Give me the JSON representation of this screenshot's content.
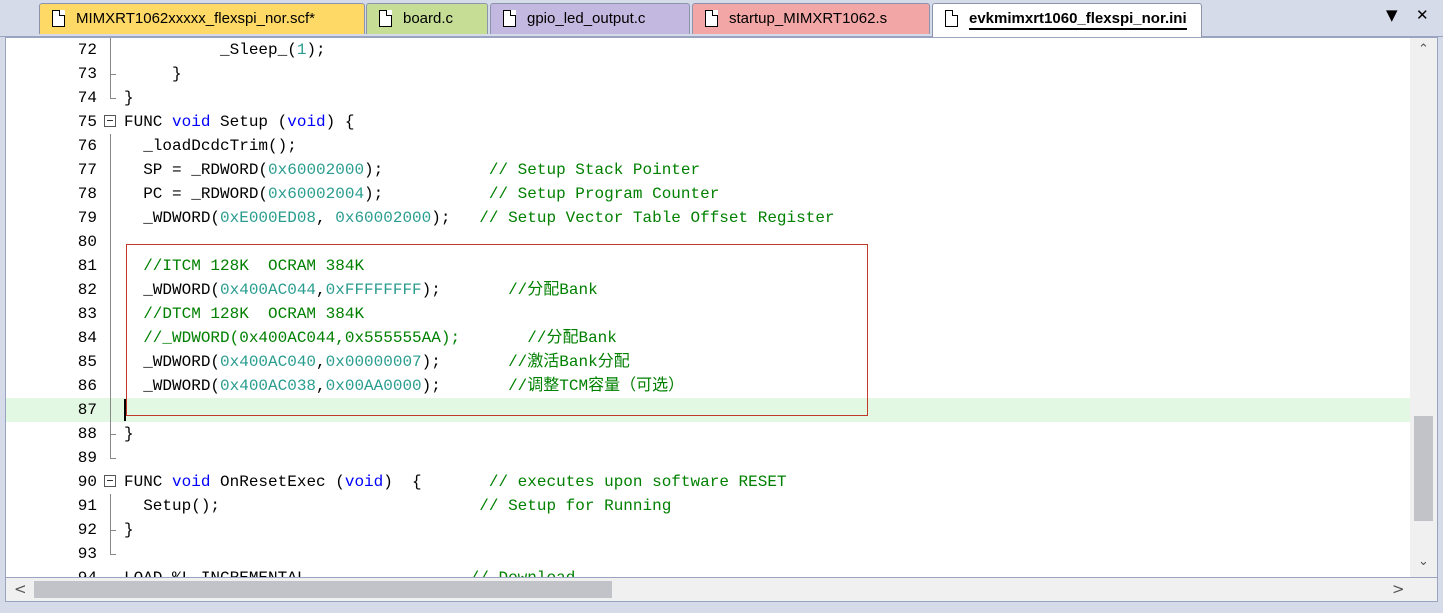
{
  "tabs": [
    {
      "label": "MIMXRT1062xxxxx_flexspi_nor.scf*",
      "color": "#ffd966",
      "active": false
    },
    {
      "label": "board.c",
      "color": "#c5dd95",
      "active": false
    },
    {
      "label": "gpio_led_output.c",
      "color": "#c3b8e0",
      "active": false
    },
    {
      "label": "startup_MIMXRT1062.s",
      "color": "#f2a6a6",
      "active": false
    },
    {
      "label": "evkmimxrt1060_flexspi_nor.ini",
      "color": "#ffffff",
      "active": true
    }
  ],
  "tab_controls": {
    "dropdown": "▼",
    "close": "✕"
  },
  "colors": {
    "keyword": "#0000ff",
    "number": "#2a9d8f",
    "comment": "#008000",
    "current_line": "#e3f8e3",
    "annotation_box": "#c0392b"
  },
  "editor": {
    "current_line": "87",
    "lines": [
      {
        "num": "72",
        "fold": "vline",
        "tokens": [
          {
            "t": "          _Sleep_(",
            "c": "plain"
          },
          {
            "t": "1",
            "c": "num"
          },
          {
            "t": ");",
            "c": "plain"
          }
        ]
      },
      {
        "num": "73",
        "fold": "mid",
        "tokens": [
          {
            "t": "     }",
            "c": "plain"
          }
        ]
      },
      {
        "num": "74",
        "fold": "end",
        "tokens": [
          {
            "t": "}",
            "c": "plain"
          }
        ]
      },
      {
        "num": "75",
        "fold": "box",
        "tokens": [
          {
            "t": "FUNC ",
            "c": "plain"
          },
          {
            "t": "void",
            "c": "kw"
          },
          {
            "t": " Setup (",
            "c": "plain"
          },
          {
            "t": "void",
            "c": "kw"
          },
          {
            "t": ") {",
            "c": "plain"
          }
        ]
      },
      {
        "num": "76",
        "fold": "vline",
        "tokens": [
          {
            "t": "  _loadDcdcTrim();",
            "c": "plain"
          }
        ]
      },
      {
        "num": "77",
        "fold": "vline",
        "tokens": [
          {
            "t": "  SP = _RDWORD(",
            "c": "plain"
          },
          {
            "t": "0x60002000",
            "c": "num"
          },
          {
            "t": ");           ",
            "c": "plain"
          },
          {
            "t": "// Setup Stack Pointer",
            "c": "cm"
          }
        ]
      },
      {
        "num": "78",
        "fold": "vline",
        "tokens": [
          {
            "t": "  PC = _RDWORD(",
            "c": "plain"
          },
          {
            "t": "0x60002004",
            "c": "num"
          },
          {
            "t": ");           ",
            "c": "plain"
          },
          {
            "t": "// Setup Program Counter",
            "c": "cm"
          }
        ]
      },
      {
        "num": "79",
        "fold": "vline",
        "tokens": [
          {
            "t": "  _WDWORD(",
            "c": "plain"
          },
          {
            "t": "0xE000ED08",
            "c": "num"
          },
          {
            "t": ", ",
            "c": "plain"
          },
          {
            "t": "0x60002000",
            "c": "num"
          },
          {
            "t": ");   ",
            "c": "plain"
          },
          {
            "t": "// Setup Vector Table Offset Register",
            "c": "cm"
          }
        ]
      },
      {
        "num": "80",
        "fold": "vline",
        "tokens": []
      },
      {
        "num": "81",
        "fold": "vline",
        "tokens": [
          {
            "t": "  ",
            "c": "plain"
          },
          {
            "t": "//ITCM 128K  OCRAM 384K",
            "c": "cm"
          }
        ]
      },
      {
        "num": "82",
        "fold": "vline",
        "tokens": [
          {
            "t": "  _WDWORD(",
            "c": "plain"
          },
          {
            "t": "0x400AC044",
            "c": "num"
          },
          {
            "t": ",",
            "c": "plain"
          },
          {
            "t": "0xFFFFFFFF",
            "c": "num"
          },
          {
            "t": ");       ",
            "c": "plain"
          },
          {
            "t": "//分配Bank",
            "c": "cm"
          }
        ]
      },
      {
        "num": "83",
        "fold": "vline",
        "tokens": [
          {
            "t": "  ",
            "c": "plain"
          },
          {
            "t": "//DTCM 128K  OCRAM 384K",
            "c": "cm"
          }
        ]
      },
      {
        "num": "84",
        "fold": "vline",
        "tokens": [
          {
            "t": "  ",
            "c": "plain"
          },
          {
            "t": "//_WDWORD(0x400AC044,0x555555AA);       //分配Bank",
            "c": "cm"
          }
        ]
      },
      {
        "num": "85",
        "fold": "vline",
        "tokens": [
          {
            "t": "  _WDWORD(",
            "c": "plain"
          },
          {
            "t": "0x400AC040",
            "c": "num"
          },
          {
            "t": ",",
            "c": "plain"
          },
          {
            "t": "0x00000007",
            "c": "num"
          },
          {
            "t": ");       ",
            "c": "plain"
          },
          {
            "t": "//激活Bank分配",
            "c": "cm"
          }
        ]
      },
      {
        "num": "86",
        "fold": "vline",
        "tokens": [
          {
            "t": "  _WDWORD(",
            "c": "plain"
          },
          {
            "t": "0x400AC038",
            "c": "num"
          },
          {
            "t": ",",
            "c": "plain"
          },
          {
            "t": "0x00AA0000",
            "c": "num"
          },
          {
            "t": ");       ",
            "c": "plain"
          },
          {
            "t": "//调整TCM容量（可选）",
            "c": "cm"
          }
        ]
      },
      {
        "num": "87",
        "fold": "vline",
        "tokens": []
      },
      {
        "num": "88",
        "fold": "mid",
        "tokens": [
          {
            "t": "}",
            "c": "plain"
          }
        ]
      },
      {
        "num": "89",
        "fold": "end",
        "tokens": []
      },
      {
        "num": "90",
        "fold": "box",
        "tokens": [
          {
            "t": "FUNC ",
            "c": "plain"
          },
          {
            "t": "void",
            "c": "kw"
          },
          {
            "t": " OnResetExec (",
            "c": "plain"
          },
          {
            "t": "void",
            "c": "kw"
          },
          {
            "t": ")  {       ",
            "c": "plain"
          },
          {
            "t": "// executes upon software RESET",
            "c": "cm"
          }
        ]
      },
      {
        "num": "91",
        "fold": "vline",
        "tokens": [
          {
            "t": "  Setup();                           ",
            "c": "plain"
          },
          {
            "t": "// Setup for Running",
            "c": "cm"
          }
        ]
      },
      {
        "num": "92",
        "fold": "mid",
        "tokens": [
          {
            "t": "}",
            "c": "plain"
          }
        ]
      },
      {
        "num": "93",
        "fold": "end",
        "tokens": []
      },
      {
        "num": "94",
        "fold": "",
        "tokens": [
          {
            "t": "LOAD %L INCREMENTAL",
            "c": "plain"
          },
          {
            "t": "                 ",
            "c": "plain"
          },
          {
            "t": "// Download",
            "c": "cm"
          }
        ]
      }
    ]
  },
  "scrollbars": {
    "up": "⌃",
    "down": "⌄",
    "left": "<",
    "right": ">"
  }
}
